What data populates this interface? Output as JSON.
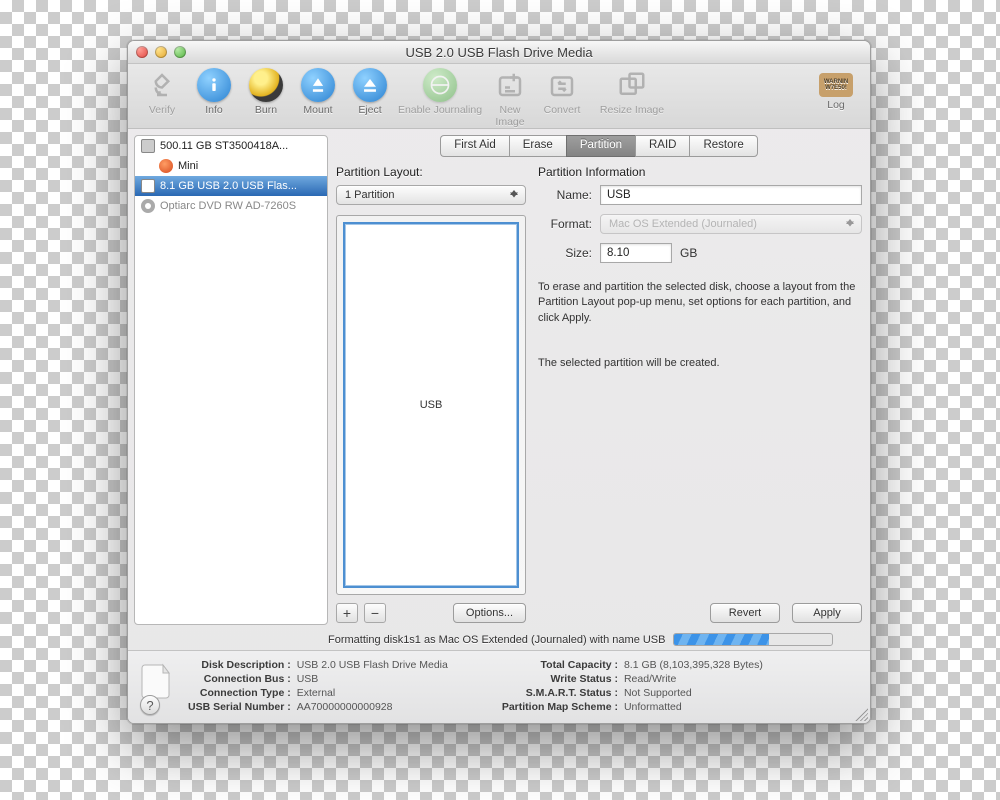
{
  "window_title": "USB 2.0 USB Flash Drive Media",
  "toolbar": {
    "verify": "Verify",
    "info": "Info",
    "burn": "Burn",
    "mount": "Mount",
    "eject": "Eject",
    "enable_journaling": "Enable Journaling",
    "new_image": "New Image",
    "convert": "Convert",
    "resize_image": "Resize Image",
    "log": "Log"
  },
  "sidebar": {
    "items": [
      {
        "label": "500.11 GB ST3500418A..."
      },
      {
        "label": "Mini"
      },
      {
        "label": "8.1 GB USB 2.0 USB Flas..."
      },
      {
        "label": "Optiarc DVD RW AD-7260S"
      }
    ]
  },
  "tabs": {
    "first_aid": "First Aid",
    "erase": "Erase",
    "partition": "Partition",
    "raid": "RAID",
    "restore": "Restore"
  },
  "partition": {
    "layout_heading": "Partition Layout:",
    "layout_select": "1 Partition",
    "vis_label": "USB",
    "add_label": "+",
    "remove_label": "−",
    "options_btn": "Options...",
    "info_heading": "Partition Information",
    "name_label": "Name:",
    "name_value": "USB",
    "format_label": "Format:",
    "format_value": "Mac OS Extended (Journaled)",
    "size_label": "Size:",
    "size_value": "8.10",
    "size_unit": "GB",
    "help_1": "To erase and partition the selected disk, choose a layout from the Partition Layout pop-up menu, set options for each partition, and click Apply.",
    "help_2": "The selected partition will be created.",
    "revert_btn": "Revert",
    "apply_btn": "Apply"
  },
  "progress_text": "Formatting disk1s1 as Mac OS Extended (Journaled) with name USB",
  "footer": {
    "left": {
      "disk_description_k": "Disk Description :",
      "disk_description_v": "USB 2.0 USB Flash Drive Media",
      "connection_bus_k": "Connection Bus :",
      "connection_bus_v": "USB",
      "connection_type_k": "Connection Type :",
      "connection_type_v": "External",
      "usb_serial_k": "USB Serial Number :",
      "usb_serial_v": "AA70000000000928"
    },
    "right": {
      "total_capacity_k": "Total Capacity :",
      "total_capacity_v": "8.1 GB (8,103,395,328 Bytes)",
      "write_status_k": "Write Status :",
      "write_status_v": "Read/Write",
      "smart_k": "S.M.A.R.T. Status :",
      "smart_v": "Not Supported",
      "scheme_k": "Partition Map Scheme :",
      "scheme_v": "Unformatted"
    }
  },
  "help_btn": "?"
}
